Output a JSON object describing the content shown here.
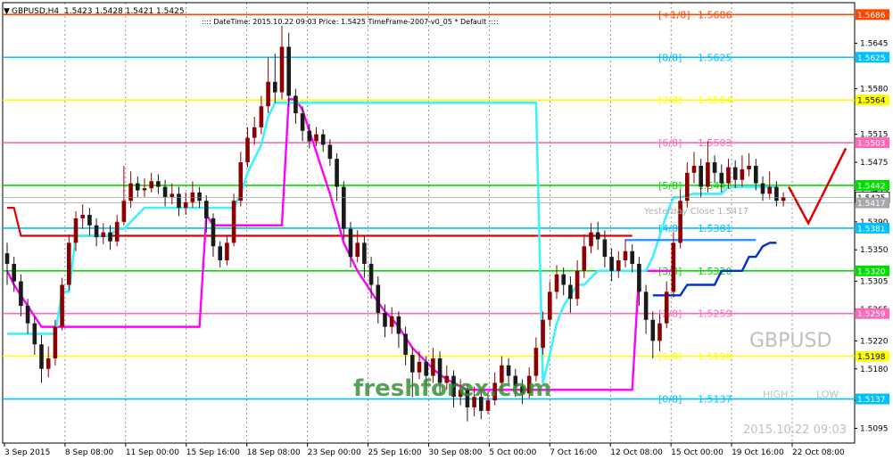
{
  "header": {
    "symbol_label": "GBPUSD,H4",
    "ohlc": "1.5423 1.5428 1.5421 1.5425",
    "info": ":::: DateTime: 2015.10.22 09:03    Price: 1.5425    TimeFrame-2007-v0_05    *  Default  ::::"
  },
  "watermark": {
    "symbol": "GBPUSD",
    "high_label": "HIGH",
    "low_label": "LOW",
    "datetime": "2015.10.22 09:03",
    "brand": "freshforex.com"
  },
  "colors": {
    "bull": "#8b0000",
    "bear": "#1a1a1a",
    "cyan": "#3ff0ff",
    "magenta": "#ff00ff",
    "red": "#e00000",
    "blue": "#0033cc",
    "dodger": "#1e90ff"
  },
  "chart_data": {
    "type": "candlestick",
    "symbol": "GBPUSD",
    "timeframe": "H4",
    "y_range": [
      1.5074,
      1.5703
    ],
    "y_ticks": [
      1.5645,
      1.558,
      1.5515,
      1.5475,
      1.5435,
      1.539,
      1.535,
      1.5305,
      1.5265,
      1.522,
      1.518,
      1.5135,
      1.5095
    ],
    "x_ticks": [
      "3 Sep 2015",
      "8 Sep 08:00",
      "11 Sep 00:00",
      "15 Sep 16:00",
      "18 Sep 08:00",
      "23 Sep 00:00",
      "25 Sep 16:00",
      "30 Sep 08:00",
      "5 Oct 00:00",
      "7 Oct 16:00",
      "12 Oct 08:00",
      "15 Oct 00:00",
      "19 Oct 16:00",
      "22 Oct 08:00"
    ],
    "current_price": 1.5425,
    "yesterday_close": 1.5417,
    "yesterday_close_label": "Yesterday Close 1.5417",
    "murrey_levels": [
      {
        "name": "[+1/8]",
        "value": 1.5686,
        "color": "#ff4500"
      },
      {
        "name": "[8/8]",
        "value": 1.5625,
        "color": "#00bfff"
      },
      {
        "name": "[7/8]",
        "value": 1.5564,
        "color": "#ffff00"
      },
      {
        "name": "[6/8]",
        "value": 1.5503,
        "color": "#ff69b4"
      },
      {
        "name": "[5/8]",
        "value": 1.5442,
        "color": "#00dd00"
      },
      {
        "name": "[4/8]",
        "value": 1.5381,
        "color": "#00bfff"
      },
      {
        "name": "[3/8]",
        "value": 1.532,
        "color": "#00dd00"
      },
      {
        "name": "[2/8]",
        "value": 1.5259,
        "color": "#ff69b4"
      },
      {
        "name": "[1/8]",
        "value": 1.5198,
        "color": "#ffff00"
      },
      {
        "name": "[0/8]",
        "value": 1.5137,
        "color": "#00bfff"
      }
    ],
    "forecast": [
      [
        1.544,
        1.5388,
        1.5495
      ]
    ],
    "candles": [
      [
        1.5345,
        1.533,
        1.536,
        1.53
      ],
      [
        1.533,
        1.5305,
        1.534,
        1.529
      ],
      [
        1.5305,
        1.527,
        1.5315,
        1.5255
      ],
      [
        1.527,
        1.5245,
        1.528,
        1.523
      ],
      [
        1.5245,
        1.5215,
        1.5255,
        1.52
      ],
      [
        1.5215,
        1.518,
        1.5228,
        1.516
      ],
      [
        1.518,
        1.5195,
        1.5212,
        1.5168
      ],
      [
        1.5195,
        1.524,
        1.525,
        1.5185
      ],
      [
        1.524,
        1.53,
        1.531,
        1.5235
      ],
      [
        1.53,
        1.536,
        1.5372,
        1.5292
      ],
      [
        1.536,
        1.5395,
        1.5405,
        1.5348
      ],
      [
        1.5395,
        1.54,
        1.5415,
        1.538
      ],
      [
        1.54,
        1.5385,
        1.541,
        1.537
      ],
      [
        1.5385,
        1.5368,
        1.5395,
        1.5355
      ],
      [
        1.5368,
        1.5375,
        1.5388,
        1.5358
      ],
      [
        1.5375,
        1.5362,
        1.5385,
        1.535
      ],
      [
        1.5362,
        1.539,
        1.54,
        1.5355
      ],
      [
        1.539,
        1.542,
        1.547,
        1.5385
      ],
      [
        1.542,
        1.5445,
        1.5462,
        1.541
      ],
      [
        1.5445,
        1.5435,
        1.5455,
        1.5425
      ],
      [
        1.5435,
        1.5438,
        1.5452,
        1.5425
      ],
      [
        1.5438,
        1.5448,
        1.546,
        1.5432
      ],
      [
        1.5448,
        1.544,
        1.5458,
        1.543
      ],
      [
        1.544,
        1.5425,
        1.545,
        1.5412
      ],
      [
        1.5425,
        1.543,
        1.5445,
        1.5415
      ],
      [
        1.543,
        1.541,
        1.544,
        1.5398
      ],
      [
        1.541,
        1.5418,
        1.5432,
        1.54
      ],
      [
        1.5418,
        1.5432,
        1.5448,
        1.541
      ],
      [
        1.5432,
        1.542,
        1.544,
        1.541
      ],
      [
        1.542,
        1.5395,
        1.5428,
        1.5375
      ],
      [
        1.5395,
        1.5355,
        1.5402,
        1.534
      ],
      [
        1.5355,
        1.5335,
        1.5362,
        1.5325
      ],
      [
        1.5335,
        1.536,
        1.537,
        1.5328
      ],
      [
        1.536,
        1.542,
        1.543,
        1.5355
      ],
      [
        1.542,
        1.5475,
        1.549,
        1.5412
      ],
      [
        1.5475,
        1.551,
        1.5525,
        1.5468
      ],
      [
        1.551,
        1.5525,
        1.554,
        1.55
      ],
      [
        1.5525,
        1.5555,
        1.557,
        1.5515
      ],
      [
        1.5555,
        1.559,
        1.5625,
        1.5545
      ],
      [
        1.559,
        1.5575,
        1.563,
        1.556
      ],
      [
        1.5575,
        1.564,
        1.567,
        1.5565
      ],
      [
        1.564,
        1.557,
        1.566,
        1.5555
      ],
      [
        1.557,
        1.5545,
        1.558,
        1.553
      ],
      [
        1.5545,
        1.552,
        1.5555,
        1.5505
      ],
      [
        1.552,
        1.5505,
        1.553,
        1.5495
      ],
      [
        1.5505,
        1.5515,
        1.5525,
        1.5498
      ],
      [
        1.5515,
        1.55,
        1.5522,
        1.549
      ],
      [
        1.55,
        1.548,
        1.5508,
        1.547
      ],
      [
        1.548,
        1.544,
        1.5488,
        1.542
      ],
      [
        1.544,
        1.538,
        1.5448,
        1.5365
      ],
      [
        1.538,
        1.534,
        1.539,
        1.5325
      ],
      [
        1.534,
        1.536,
        1.5378,
        1.5332
      ],
      [
        1.536,
        1.533,
        1.537,
        1.531
      ],
      [
        1.533,
        1.53,
        1.534,
        1.528
      ],
      [
        1.53,
        1.526,
        1.5312,
        1.5245
      ],
      [
        1.526,
        1.524,
        1.5272,
        1.5225
      ],
      [
        1.524,
        1.5255,
        1.5268,
        1.523
      ],
      [
        1.5255,
        1.523,
        1.5262,
        1.521
      ],
      [
        1.523,
        1.52,
        1.524,
        1.5185
      ],
      [
        1.52,
        1.5175,
        1.521,
        1.514
      ],
      [
        1.5175,
        1.519,
        1.5205,
        1.5165
      ],
      [
        1.519,
        1.517,
        1.5198,
        1.5155
      ],
      [
        1.517,
        1.5195,
        1.521,
        1.516
      ],
      [
        1.5195,
        1.516,
        1.5205,
        1.5145
      ],
      [
        1.516,
        1.517,
        1.5185,
        1.515
      ],
      [
        1.517,
        1.514,
        1.5178,
        1.5125
      ],
      [
        1.514,
        1.515,
        1.5165,
        1.5128
      ],
      [
        1.515,
        1.5125,
        1.5158,
        1.5105
      ],
      [
        1.5125,
        1.514,
        1.5155,
        1.5112
      ],
      [
        1.514,
        1.512,
        1.515,
        1.5108
      ],
      [
        1.512,
        1.5135,
        1.5148,
        1.5115
      ],
      [
        1.5135,
        1.516,
        1.5175,
        1.5128
      ],
      [
        1.516,
        1.5185,
        1.5198,
        1.515
      ],
      [
        1.5185,
        1.517,
        1.5195,
        1.5158
      ],
      [
        1.517,
        1.5155,
        1.518,
        1.514
      ],
      [
        1.5155,
        1.5145,
        1.5165,
        1.513
      ],
      [
        1.5145,
        1.517,
        1.5182,
        1.5138
      ],
      [
        1.517,
        1.521,
        1.5225,
        1.5162
      ],
      [
        1.521,
        1.525,
        1.5262,
        1.52
      ],
      [
        1.525,
        1.529,
        1.5305,
        1.524
      ],
      [
        1.529,
        1.5315,
        1.5328,
        1.528
      ],
      [
        1.5315,
        1.53,
        1.5325,
        1.5285
      ],
      [
        1.53,
        1.528,
        1.5312,
        1.526
      ],
      [
        1.528,
        1.532,
        1.5335,
        1.527
      ],
      [
        1.532,
        1.5355,
        1.5372,
        1.531
      ],
      [
        1.5355,
        1.5375,
        1.5388,
        1.5345
      ],
      [
        1.5375,
        1.5365,
        1.539,
        1.535
      ],
      [
        1.5365,
        1.534,
        1.5378,
        1.5325
      ],
      [
        1.534,
        1.532,
        1.5352,
        1.5305
      ],
      [
        1.532,
        1.5335,
        1.5348,
        1.531
      ],
      [
        1.5335,
        1.5348,
        1.5365,
        1.5325
      ],
      [
        1.5348,
        1.533,
        1.5358,
        1.5318
      ],
      [
        1.533,
        1.529,
        1.534,
        1.527
      ],
      [
        1.529,
        1.525,
        1.53,
        1.523
      ],
      [
        1.525,
        1.522,
        1.5262,
        1.5195
      ],
      [
        1.522,
        1.5245,
        1.5258,
        1.5205
      ],
      [
        1.5245,
        1.529,
        1.5305,
        1.5238
      ],
      [
        1.529,
        1.536,
        1.5375,
        1.5282
      ],
      [
        1.536,
        1.542,
        1.5435,
        1.5352
      ],
      [
        1.542,
        1.546,
        1.5475,
        1.541
      ],
      [
        1.546,
        1.547,
        1.549,
        1.5445
      ],
      [
        1.547,
        1.544,
        1.548,
        1.5425
      ],
      [
        1.544,
        1.5475,
        1.5505,
        1.5432
      ],
      [
        1.5475,
        1.546,
        1.5485,
        1.5445
      ],
      [
        1.546,
        1.5445,
        1.5472,
        1.5432
      ],
      [
        1.5445,
        1.5468,
        1.548,
        1.5438
      ],
      [
        1.5468,
        1.545,
        1.5478,
        1.5438
      ],
      [
        1.545,
        1.5465,
        1.5485,
        1.544
      ],
      [
        1.5465,
        1.547,
        1.5488,
        1.5455
      ],
      [
        1.547,
        1.5445,
        1.548,
        1.5435
      ],
      [
        1.5445,
        1.543,
        1.5455,
        1.542
      ],
      [
        1.543,
        1.544,
        1.5462,
        1.5422
      ],
      [
        1.544,
        1.542,
        1.5448,
        1.5412
      ],
      [
        1.542,
        1.5425,
        1.5432,
        1.5412
      ]
    ],
    "indicators": {
      "cyan_line": [
        1.523,
        1.523,
        1.523,
        1.523,
        1.523,
        1.523,
        1.523,
        1.523,
        1.529,
        1.529,
        1.537,
        1.537,
        1.537,
        1.537,
        1.537,
        1.537,
        1.538,
        1.538,
        1.539,
        1.54,
        1.541,
        1.541,
        1.541,
        1.541,
        1.541,
        1.541,
        1.541,
        1.541,
        1.541,
        1.541,
        1.541,
        1.541,
        1.541,
        1.541,
        1.543,
        1.546,
        1.548,
        1.55,
        1.554,
        1.556,
        1.556,
        1.556,
        1.556,
        1.556,
        1.556,
        1.556,
        1.556,
        1.556,
        1.556,
        1.556,
        1.556,
        1.556,
        1.556,
        1.556,
        1.556,
        1.556,
        1.556,
        1.556,
        1.556,
        1.556,
        1.556,
        1.556,
        1.556,
        1.556,
        1.556,
        1.556,
        1.556,
        1.556,
        1.556,
        1.556,
        1.556,
        1.556,
        1.556,
        1.556,
        1.556,
        1.556,
        1.556,
        1.556,
        1.516,
        1.52,
        1.5245,
        1.527,
        1.5285,
        1.53,
        1.53,
        1.531,
        1.532,
        1.532,
        1.532,
        1.532,
        1.532,
        1.532,
        1.532,
        1.532,
        1.534,
        1.537,
        1.54,
        1.5425,
        1.5425,
        1.5428,
        1.543,
        1.543,
        1.543,
        1.543,
        1.543,
        1.544,
        1.544,
        1.544,
        1.544,
        1.544,
        1.544,
        1.544,
        1.544
      ],
      "magenta_line": [
        1.532,
        1.53,
        1.5285,
        1.527,
        1.5255,
        1.524,
        1.524,
        1.524,
        1.524,
        1.524,
        1.524,
        1.524,
        1.524,
        1.524,
        1.524,
        1.524,
        1.524,
        1.524,
        1.524,
        1.524,
        1.524,
        1.524,
        1.524,
        1.524,
        1.524,
        1.524,
        1.524,
        1.524,
        1.524,
        1.54,
        1.5385,
        1.5385,
        1.5385,
        1.5385,
        1.5385,
        1.5385,
        1.5385,
        1.5385,
        1.5385,
        1.5385,
        1.5385,
        1.5565,
        1.5565,
        1.555,
        1.552,
        1.549,
        1.546,
        1.543,
        1.5395,
        1.536,
        1.534,
        1.532,
        1.5305,
        1.529,
        1.5275,
        1.5262,
        1.5252,
        1.524,
        1.5225,
        1.521,
        1.52,
        1.519,
        1.518,
        1.5172,
        1.5165,
        1.516,
        1.5155,
        1.515,
        1.515,
        1.515,
        1.515,
        1.515,
        1.515,
        1.515,
        1.515,
        1.515,
        1.515,
        1.515,
        1.515,
        1.515,
        1.515,
        1.515,
        1.515,
        1.515,
        1.515,
        1.515,
        1.515,
        1.515,
        1.515,
        1.515,
        1.515,
        1.515,
        1.532,
        1.532,
        1.532,
        1.532,
        1.532,
        1.532
      ],
      "red_line": [
        1.541,
        1.541,
        1.537,
        1.537,
        1.537,
        1.537,
        1.537,
        1.537,
        1.537,
        1.537,
        1.537,
        1.537,
        1.537,
        1.537,
        1.537,
        1.537,
        1.537,
        1.537,
        1.537,
        1.537,
        1.537,
        1.537,
        1.537,
        1.537,
        1.537,
        1.537,
        1.537,
        1.537,
        1.537,
        1.537,
        1.537,
        1.537,
        1.537,
        1.537,
        1.537,
        1.537,
        1.537,
        1.537,
        1.537,
        1.537,
        1.537,
        1.537,
        1.537,
        1.537,
        1.537,
        1.537,
        1.537,
        1.537,
        1.537,
        1.537,
        1.537,
        1.537,
        1.537,
        1.537,
        1.537,
        1.537,
        1.537,
        1.537,
        1.537,
        1.537,
        1.537,
        1.537,
        1.537,
        1.537,
        1.537,
        1.537,
        1.537,
        1.537,
        1.537,
        1.537,
        1.537,
        1.537,
        1.537,
        1.537,
        1.537,
        1.537,
        1.537,
        1.537,
        1.537,
        1.537,
        1.537,
        1.537,
        1.537,
        1.537,
        1.537,
        1.537,
        1.537,
        1.537,
        1.537,
        1.537,
        1.537,
        1.537
      ],
      "blue_line": [
        1.5285,
        1.5285,
        1.5285,
        1.5285,
        1.5285,
        1.53,
        1.53,
        1.53,
        1.53,
        1.53,
        1.532,
        1.532,
        1.532,
        1.532,
        1.534,
        1.534,
        1.5355,
        1.536,
        1.536
      ]
    }
  }
}
